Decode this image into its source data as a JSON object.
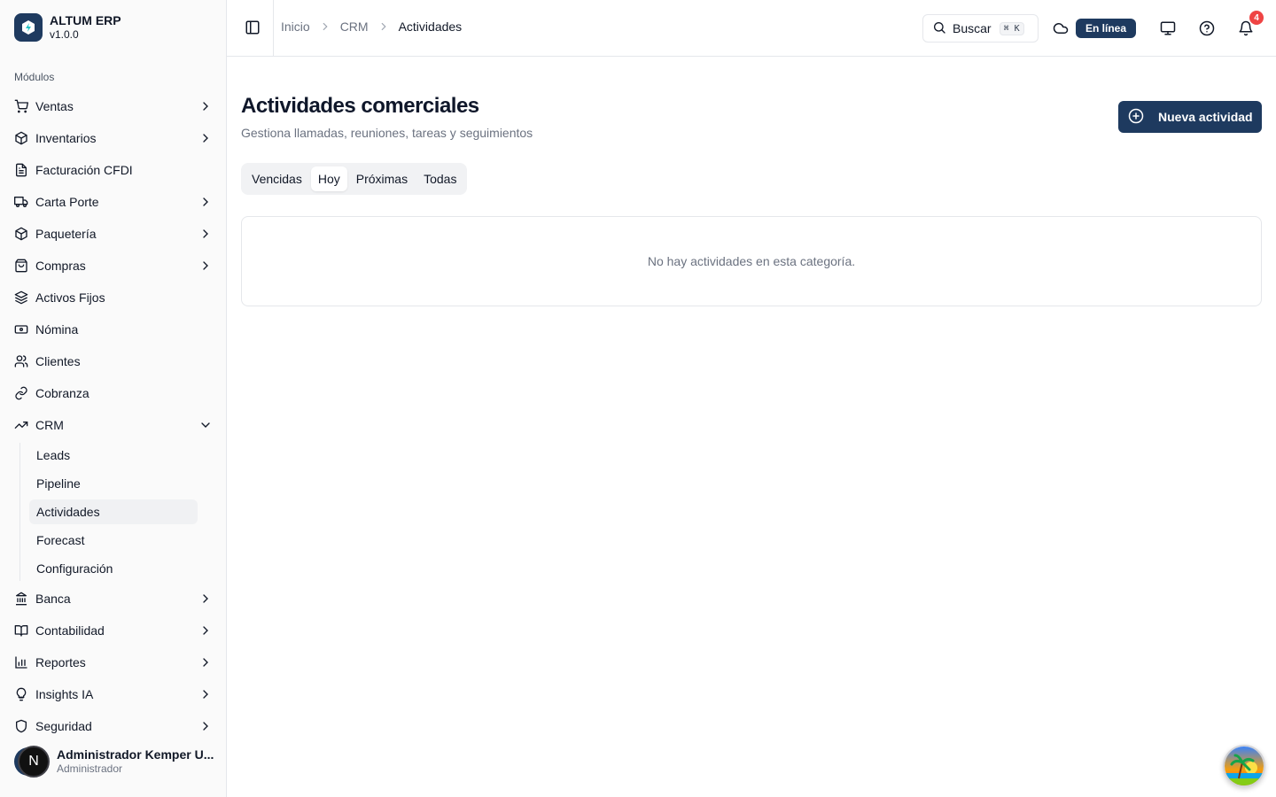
{
  "brand": {
    "name": "ALTUM ERP",
    "version": "v1.0.0"
  },
  "sidebar": {
    "section_label": "Módulos",
    "items_top": [
      {
        "label": "Ventas"
      },
      {
        "label": "Inventarios"
      },
      {
        "label": "Facturación CFDI"
      },
      {
        "label": "Carta Porte"
      },
      {
        "label": "Paquetería"
      },
      {
        "label": "Compras"
      },
      {
        "label": "Activos Fijos"
      },
      {
        "label": "Nómina"
      },
      {
        "label": "Clientes"
      },
      {
        "label": "Cobranza"
      },
      {
        "label": "CRM"
      }
    ],
    "crm_sub": [
      {
        "label": "Leads"
      },
      {
        "label": "Pipeline"
      },
      {
        "label": "Actividades"
      },
      {
        "label": "Forecast"
      },
      {
        "label": "Configuración"
      }
    ],
    "items_bottom": [
      {
        "label": "Banca"
      },
      {
        "label": "Contabilidad"
      },
      {
        "label": "Reportes"
      },
      {
        "label": "Insights IA"
      },
      {
        "label": "Seguridad"
      }
    ]
  },
  "user": {
    "name": "Administrador Kemper U...",
    "role": "Administrador",
    "avatar_letter": "N"
  },
  "header": {
    "breadcrumb": [
      "Inicio",
      "CRM",
      "Actividades"
    ],
    "search_label": "Buscar",
    "search_shortcut": "⌘ K",
    "status_label": "En línea",
    "notification_count": "4"
  },
  "main": {
    "title": "Actividades comerciales",
    "subtitle": "Gestiona llamadas, reuniones, tareas y seguimientos",
    "new_button_label": "Nueva actividad",
    "tabs": [
      {
        "label": "Vencidas"
      },
      {
        "label": "Hoy",
        "active": true
      },
      {
        "label": "Próximas"
      },
      {
        "label": "Todas"
      }
    ],
    "empty_message": "No hay actividades en esta categoría."
  },
  "colors": {
    "primary": "#1e3a5f",
    "badge": "#ef4444",
    "border": "#e5e7eb",
    "muted_text": "#6b7280"
  }
}
